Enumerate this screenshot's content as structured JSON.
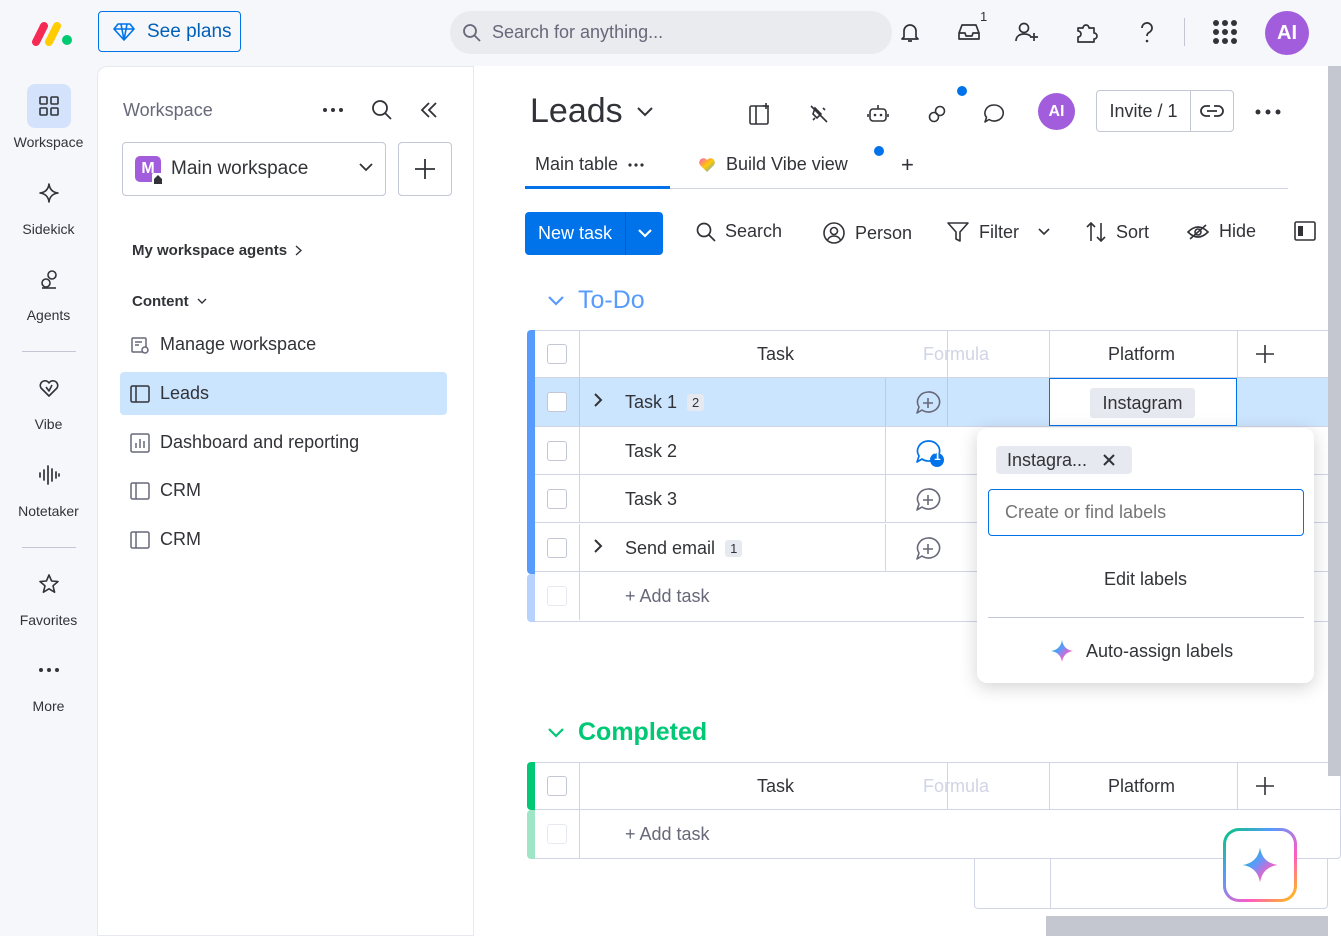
{
  "topbar": {
    "see_plans": "See plans",
    "search_placeholder": "Search for anything...",
    "inbox_count": "1",
    "avatar_initials": "AI",
    "icons": [
      "bell-icon",
      "inbox-icon",
      "invite-user-icon",
      "puzzle-icon",
      "help-icon",
      "apps-grid-icon"
    ]
  },
  "rail": {
    "items": [
      {
        "label": "Workspace",
        "icon": "grid-icon",
        "active": true
      },
      {
        "label": "Sidekick",
        "icon": "sparkle-icon"
      },
      {
        "label": "Agents",
        "icon": "agent-icon"
      },
      {
        "label": "Vibe",
        "icon": "heart-icon"
      },
      {
        "label": "Notetaker",
        "icon": "waveform-icon"
      },
      {
        "label": "Favorites",
        "icon": "star-icon"
      },
      {
        "label": "More",
        "icon": "more-dots-icon"
      }
    ]
  },
  "sidebar": {
    "title": "Workspace",
    "workspace_initial": "M",
    "workspace_name": "Main workspace",
    "agents_link": "My workspace agents",
    "content_label": "Content",
    "items": [
      {
        "label": "Manage workspace",
        "icon": "manage-workspace-icon"
      },
      {
        "label": "Leads",
        "icon": "board-icon",
        "active": true
      },
      {
        "label": "Dashboard and reporting",
        "icon": "dashboard-icon"
      },
      {
        "label": "CRM",
        "icon": "board-icon"
      },
      {
        "label": "CRM",
        "icon": "board-icon"
      }
    ]
  },
  "board": {
    "title": "Leads",
    "avatar_initials": "AI",
    "invite_label": "Invite / 1",
    "tabs": [
      {
        "label": "Main table",
        "active": true
      },
      {
        "label": "Build Vibe view"
      }
    ],
    "add_tab": "+",
    "new_task": "New task",
    "toolbar": [
      "Search",
      "Person",
      "Filter",
      "Sort",
      "Hide"
    ]
  },
  "groups": [
    {
      "name": "To-Do",
      "color": "#579bfc",
      "columns": {
        "task": "Task",
        "formula": "Formula",
        "platform": "Platform"
      },
      "rows": [
        {
          "name": "Task 1",
          "subitems": "2",
          "platform": "Instagram",
          "selected": true
        },
        {
          "name": "Task 2",
          "updates": "1"
        },
        {
          "name": "Task 3"
        },
        {
          "name": "Send email",
          "subitems": "1"
        }
      ],
      "add_task": "+ Add task"
    },
    {
      "name": "Completed",
      "color": "#00c875",
      "columns": {
        "task": "Task",
        "formula": "Formula",
        "platform": "Platform"
      },
      "rows": [],
      "add_task": "+ Add task"
    }
  ],
  "label_popup": {
    "selected_chip": "Instagra...",
    "input_placeholder": "Create or find labels",
    "edit_labels": "Edit labels",
    "auto_assign": "Auto-assign labels"
  }
}
